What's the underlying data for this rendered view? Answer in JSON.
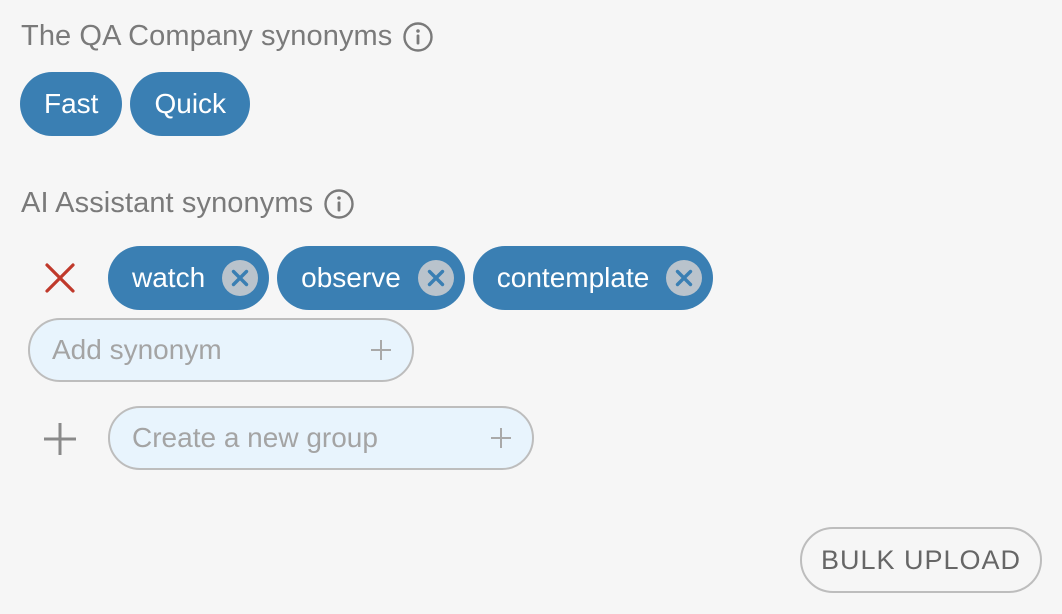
{
  "groups": [
    {
      "title": "The QA Company synonyms",
      "chips": [
        "Fast",
        "Quick"
      ]
    },
    {
      "title": "AI Assistant synonyms",
      "chips": [
        "watch",
        "observe",
        "contemplate"
      ],
      "add_synonym_placeholder": "Add synonym"
    }
  ],
  "new_group": {
    "placeholder": "Create a new group"
  },
  "bulk_upload_label": "BULK UPLOAD",
  "colors": {
    "chip": "#3a7fb3",
    "delete": "#c0392b",
    "input_bg": "#e8f4fd"
  },
  "icons": {
    "info": "info-icon",
    "chip_remove": "circle-x-icon",
    "delete_group": "x-icon",
    "add": "plus-icon"
  }
}
